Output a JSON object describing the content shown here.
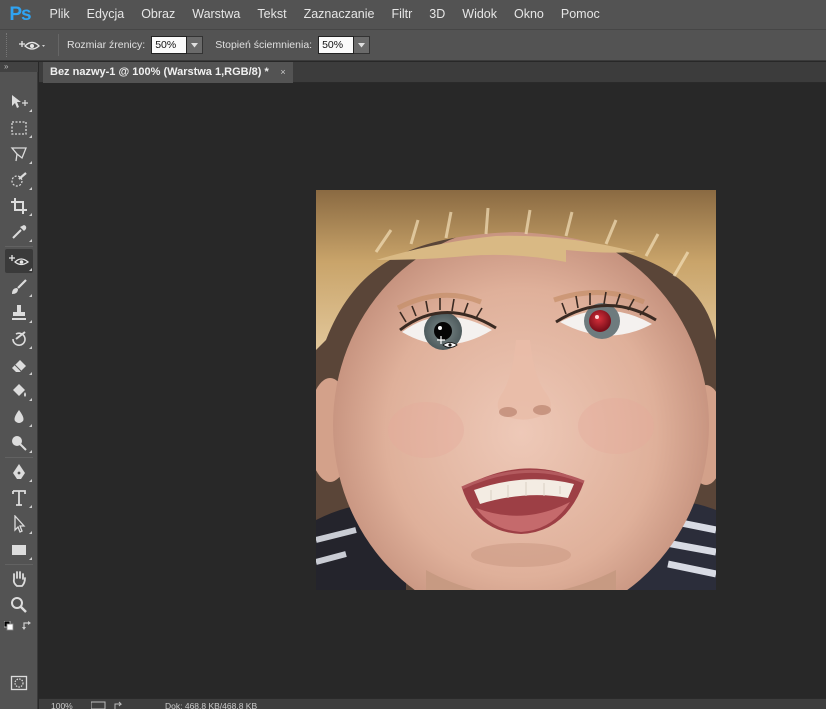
{
  "app": {
    "logo": "Ps"
  },
  "menu": [
    "Plik",
    "Edycja",
    "Obraz",
    "Warstwa",
    "Tekst",
    "Zaznaczanie",
    "Filtr",
    "3D",
    "Widok",
    "Okno",
    "Pomoc"
  ],
  "options": {
    "tool_icon": "red-eye-tool-icon",
    "pupil_label": "Rozmiar źrenicy:",
    "pupil_value": "50%",
    "darken_label": "Stopień ściemnienia:",
    "darken_value": "50%"
  },
  "tools_header": "»",
  "tools": [
    {
      "name": "move-tool-icon"
    },
    {
      "name": "marquee-tool-icon"
    },
    {
      "name": "lasso-tool-icon"
    },
    {
      "name": "quick-selection-tool-icon"
    },
    {
      "name": "crop-tool-icon"
    },
    {
      "name": "eyedropper-tool-icon"
    },
    {
      "name": "red-eye-tool-icon",
      "active": true
    },
    {
      "name": "brush-tool-icon"
    },
    {
      "name": "clone-stamp-tool-icon"
    },
    {
      "name": "history-brush-tool-icon"
    },
    {
      "name": "eraser-tool-icon"
    },
    {
      "name": "paint-bucket-tool-icon"
    },
    {
      "name": "blur-tool-icon"
    },
    {
      "name": "dodge-tool-icon"
    },
    {
      "name": "pen-tool-icon"
    },
    {
      "name": "type-tool-icon"
    },
    {
      "name": "path-selection-tool-icon"
    },
    {
      "name": "rectangle-tool-icon"
    },
    {
      "name": "hand-tool-icon"
    },
    {
      "name": "zoom-tool-icon"
    }
  ],
  "colors": {
    "foreground": "#000000",
    "background": "#ffffff",
    "accent": "#2fa3f2"
  },
  "document": {
    "tab_title": "Bez nazwy-1 @ 100% (Warstwa 1,RGB/8) *",
    "close_glyph": "×"
  },
  "status": {
    "zoom": "100%",
    "doc_size": "Dok: 468,8 KB/468,8 KB"
  }
}
